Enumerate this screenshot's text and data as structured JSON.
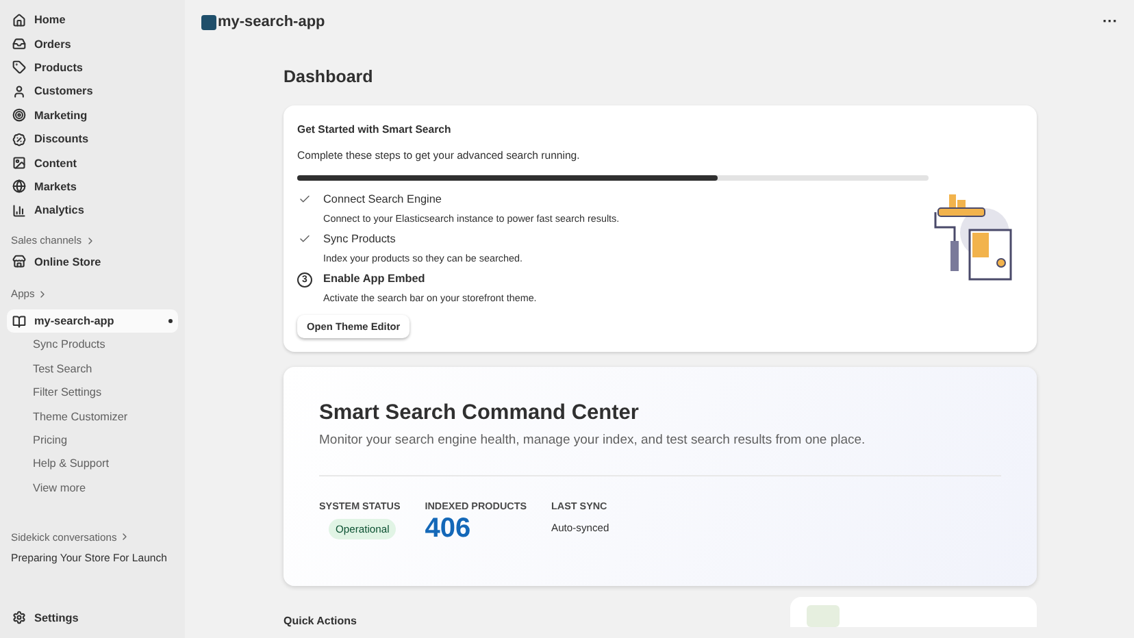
{
  "sidebar": {
    "nav": [
      {
        "label": "Home",
        "kind": "home"
      },
      {
        "label": "Orders",
        "kind": "orders"
      },
      {
        "label": "Products",
        "kind": "products"
      },
      {
        "label": "Customers",
        "kind": "customers"
      },
      {
        "label": "Marketing",
        "kind": "marketing"
      },
      {
        "label": "Discounts",
        "kind": "discounts"
      },
      {
        "label": "Content",
        "kind": "content"
      },
      {
        "label": "Markets",
        "kind": "markets"
      },
      {
        "label": "Analytics",
        "kind": "analytics"
      }
    ],
    "sales_channels": {
      "heading": "Sales channels",
      "items": [
        {
          "label": "Online Store"
        }
      ]
    },
    "apps": {
      "heading": "Apps",
      "app": {
        "label": "my-search-app",
        "selected": true
      },
      "subitems": [
        {
          "label": "Sync Products"
        },
        {
          "label": "Test Search"
        },
        {
          "label": "Filter Settings"
        },
        {
          "label": "Theme Customizer"
        },
        {
          "label": "Pricing"
        },
        {
          "label": "Help & Support"
        },
        {
          "label": "View more"
        }
      ]
    },
    "sidekick": {
      "heading": "Sidekick conversations",
      "items": [
        {
          "label": "Preparing Your Store For Launch"
        }
      ]
    },
    "settings": {
      "label": "Settings"
    }
  },
  "header": {
    "app_name": "my-search-app",
    "more": "···"
  },
  "page_title": "Dashboard",
  "setup_card": {
    "title": "Get Started with Smart Search",
    "subtitle": "Complete these steps to get your advanced search running.",
    "progress": {
      "level": 0.666
    },
    "steps": [
      {
        "kind": "done",
        "title": "Connect Search Engine",
        "description": "Connect to your Elasticsearch instance to power fast search results."
      },
      {
        "kind": "done",
        "title": "Sync Products",
        "description": "Index your products so they can be searched."
      },
      {
        "kind": "current",
        "number": "3",
        "title": "Enable App Embed",
        "description": "Activate the search bar on your storefront theme."
      }
    ],
    "button": "Open Theme Editor"
  },
  "command_center": {
    "title": "Smart Search Command Center",
    "description": "Monitor your search engine health, manage your index, and test search results from one place.",
    "stats": [
      {
        "kind": "badge",
        "label": "SYSTEM STATUS",
        "value": "Operational"
      },
      {
        "kind": "number",
        "label": "INDEXED PRODUCTS",
        "value": "406"
      },
      {
        "kind": "text",
        "label": "LAST SYNC",
        "value": "Auto-synced"
      }
    ]
  },
  "quick_actions": {
    "heading": "Quick Actions"
  }
}
